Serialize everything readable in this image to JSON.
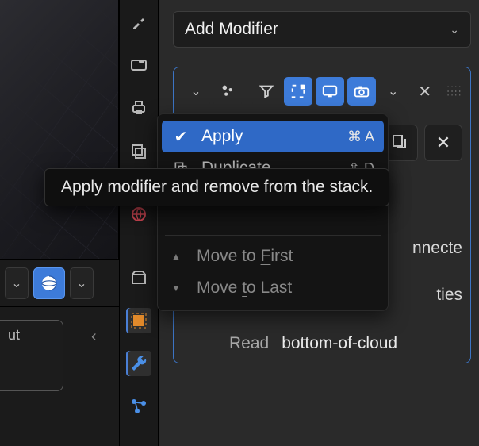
{
  "header": {
    "add_modifier_label": "Add Modifier"
  },
  "modifier": {
    "read_label": "Read",
    "read_value": "bottom-of-cloud",
    "partial_connected": "nnecte",
    "partial_ties": "ties"
  },
  "menu": {
    "apply": {
      "label": "Apply",
      "shortcut": "⌘ A"
    },
    "duplicate": {
      "label": "Duplicate",
      "shortcut_prefix": "⇧ "
    },
    "move_first_pre": "Move to ",
    "move_first_u": "F",
    "move_first_post": "irst",
    "move_last_pre": "Move ",
    "move_last_u": "t",
    "move_last_mid": "o Last"
  },
  "tooltip": {
    "text": "Apply modifier and remove from the stack."
  },
  "sidebar": {
    "out_fragment": "ut"
  }
}
